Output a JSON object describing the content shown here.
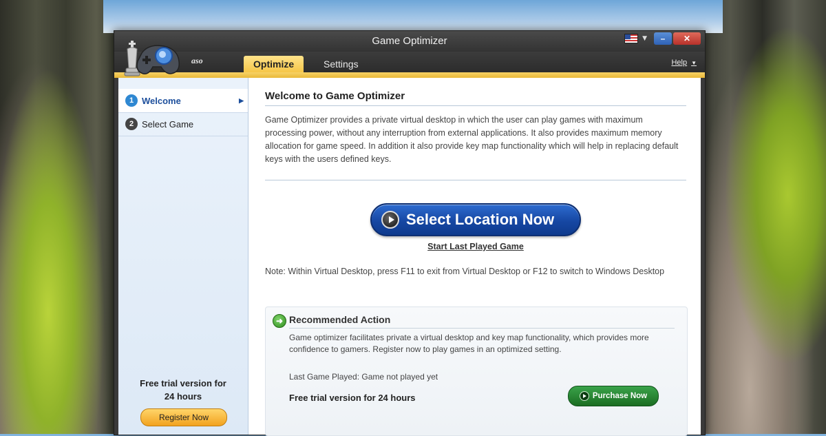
{
  "window": {
    "title": "Game Optimizer",
    "brand": "aso"
  },
  "nav": {
    "tabs": [
      {
        "label": "Optimize",
        "active": true
      },
      {
        "label": "Settings",
        "active": false
      }
    ],
    "help_label": "Help"
  },
  "sidebar": {
    "items": [
      {
        "number": "1",
        "label": "Welcome",
        "active": true
      },
      {
        "number": "2",
        "label": "Select Game",
        "active": false
      }
    ],
    "trial_line1": "Free trial version for",
    "trial_line2": "24 hours",
    "register_label": "Register Now"
  },
  "main": {
    "heading": "Welcome to Game Optimizer",
    "description": "Game Optimizer provides a private virtual desktop in which the user can play games with maximum processing power, without any interruption from external applications. It also provides maximum memory allocation for game speed. In addition it also provide key map functionality which will help in replacing default keys with the users defined keys.",
    "select_button": "Select Location Now",
    "start_last_link": "Start Last Played Game",
    "note": "Note: Within Virtual Desktop, press F11 to exit from Virtual Desktop or F12 to switch to Windows Desktop"
  },
  "recommended": {
    "title": "Recommended Action",
    "description": "Game optimizer facilitates private a virtual desktop and key map functionality, which provides more confidence to gamers. Register now to play games in an optimized setting.",
    "last_game": "Last Game Played: Game not played yet",
    "trial": "Free trial version for 24 hours",
    "purchase_label": "Purchase Now"
  },
  "colors": {
    "accent_gold": "#f5c648",
    "primary_blue": "#1647a3",
    "purchase_green": "#1b6d22",
    "register_orange": "#f2a21f"
  }
}
